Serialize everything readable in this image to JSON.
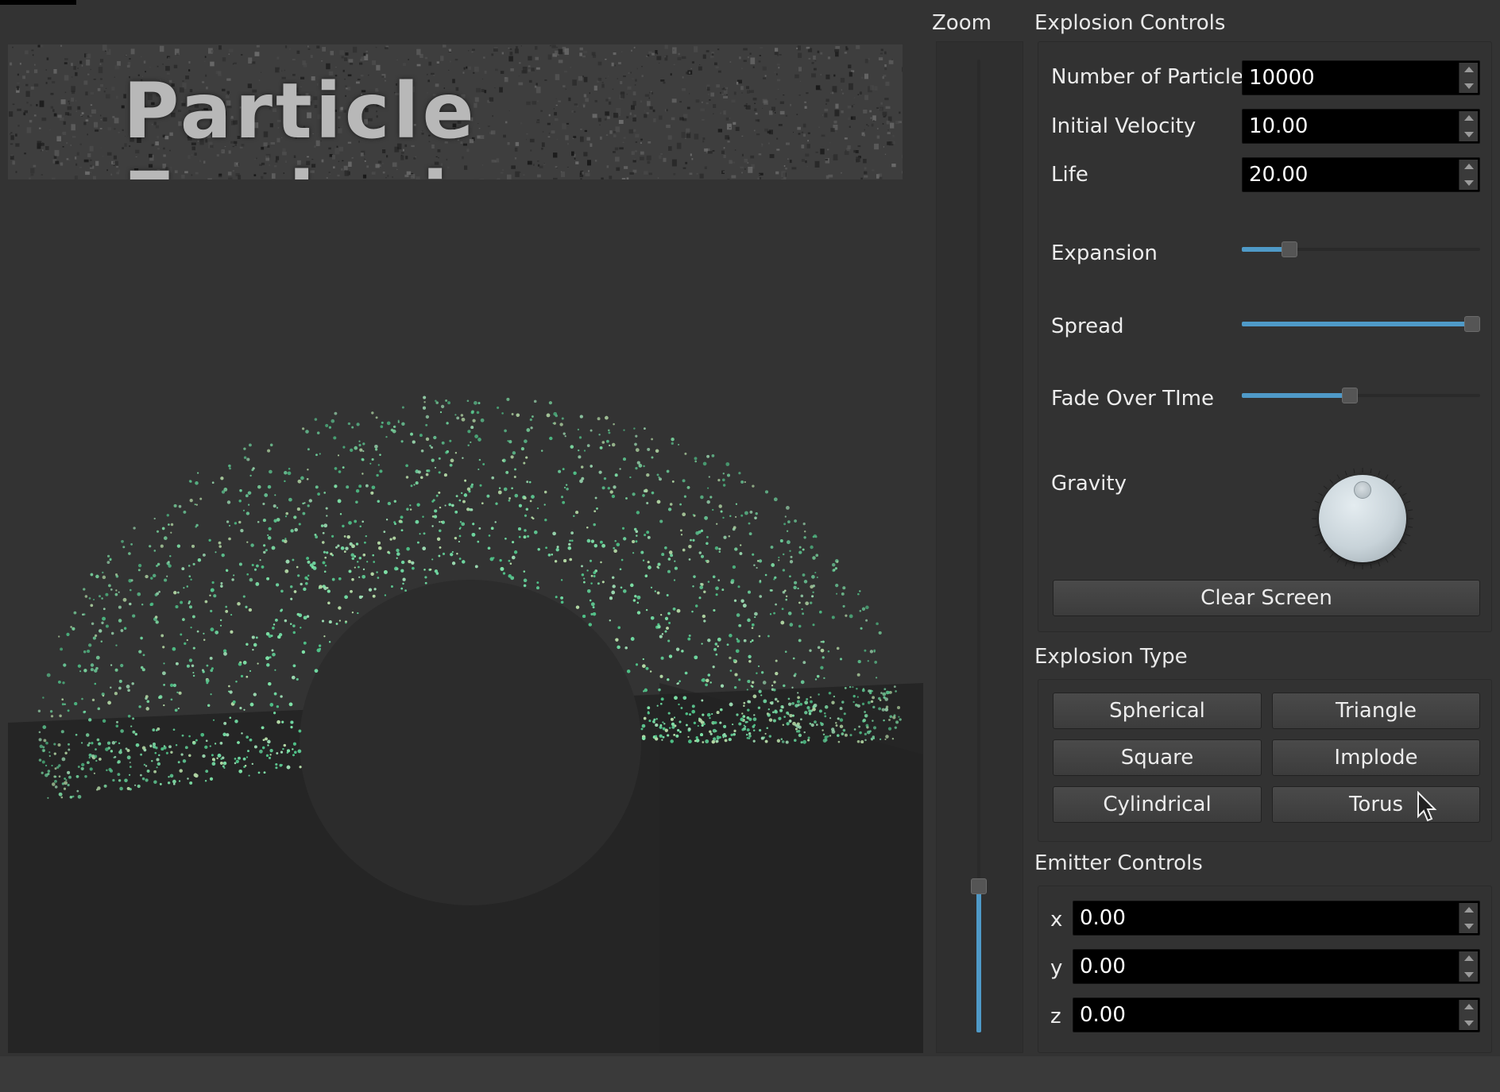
{
  "viewport": {
    "title": "Particle Explosion",
    "particle_color": "#6fd6a0",
    "floor_color": "#252525",
    "background_color": "#333333"
  },
  "zoom": {
    "label": "Zoom",
    "value_fraction": 0.15
  },
  "explosion_controls": {
    "title": "Explosion Controls",
    "number_of_particles": {
      "label": "Number of Particles",
      "value": "10000"
    },
    "initial_velocity": {
      "label": "Initial Velocity",
      "value": "10.00"
    },
    "life": {
      "label": "Life",
      "value": "20.00"
    },
    "expansion": {
      "label": "Expansion",
      "value_fraction": 0.18
    },
    "spread": {
      "label": "Spread",
      "value_fraction": 1.0
    },
    "fade_over_time": {
      "label": "Fade Over TIme",
      "value_fraction": 0.45
    },
    "gravity": {
      "label": "Gravity"
    },
    "clear_screen_label": "Clear Screen"
  },
  "explosion_type": {
    "title": "Explosion Type",
    "buttons": [
      "Spherical",
      "Triangle",
      "Square",
      "Implode",
      "Cylindrical",
      "Torus"
    ]
  },
  "emitter_controls": {
    "title": "Emitter Controls",
    "x": {
      "label": "x",
      "value": "0.00"
    },
    "y": {
      "label": "y",
      "value": "0.00"
    },
    "z": {
      "label": "z",
      "value": "0.00"
    }
  },
  "accent_color": "#4f9ac8"
}
